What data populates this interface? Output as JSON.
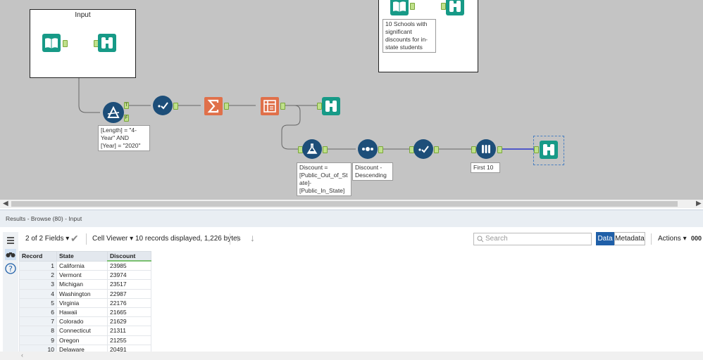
{
  "canvas": {
    "containers": [
      {
        "title": "Input"
      },
      {
        "title": ""
      }
    ],
    "annotations": {
      "schools_note": "10 Schools with\nsignificant\ndiscounts for in-\nstate students",
      "filter": "[Length] = \"4-\nYear\" AND\n[Year] = \"2020\"",
      "formula": "Discount =\n[Public_Out_of_St\nate]-\n[Public_In_State]",
      "sort": "Discount -\nDescending",
      "sample": "First 10"
    },
    "filter_anchors": {
      "true": "T",
      "false": "F"
    }
  },
  "results": {
    "title": "Results - Browse (80) - Input",
    "fields_label": "2 of 2 Fields",
    "cell_viewer": "Cell Viewer",
    "records_info": "10 records displayed, 1,226 bytes",
    "search_placeholder": "Search",
    "data_tab": "Data",
    "metadata_tab": "Metadata",
    "actions": "Actions",
    "more": "000",
    "columns": [
      "Record",
      "State",
      "Discount"
    ],
    "rows": [
      {
        "record": "1",
        "state": "California",
        "discount": "23985"
      },
      {
        "record": "2",
        "state": "Vermont",
        "discount": "23974"
      },
      {
        "record": "3",
        "state": "Michigan",
        "discount": "23517"
      },
      {
        "record": "4",
        "state": "Washington",
        "discount": "22987"
      },
      {
        "record": "5",
        "state": "Virginia",
        "discount": "22176"
      },
      {
        "record": "6",
        "state": "Hawaii",
        "discount": "21665"
      },
      {
        "record": "7",
        "state": "Colorado",
        "discount": "21629"
      },
      {
        "record": "8",
        "state": "Connecticut",
        "discount": "21311"
      },
      {
        "record": "9",
        "state": "Oregon",
        "discount": "21255"
      },
      {
        "record": "10",
        "state": "Delaware",
        "discount": "20491"
      }
    ]
  },
  "colors": {
    "canvas_bg": "#c4c4c4",
    "teal": "#179a87",
    "navy": "#1d4e79",
    "orange": "#e0704a",
    "accent_blue": "#1f5fa8"
  }
}
